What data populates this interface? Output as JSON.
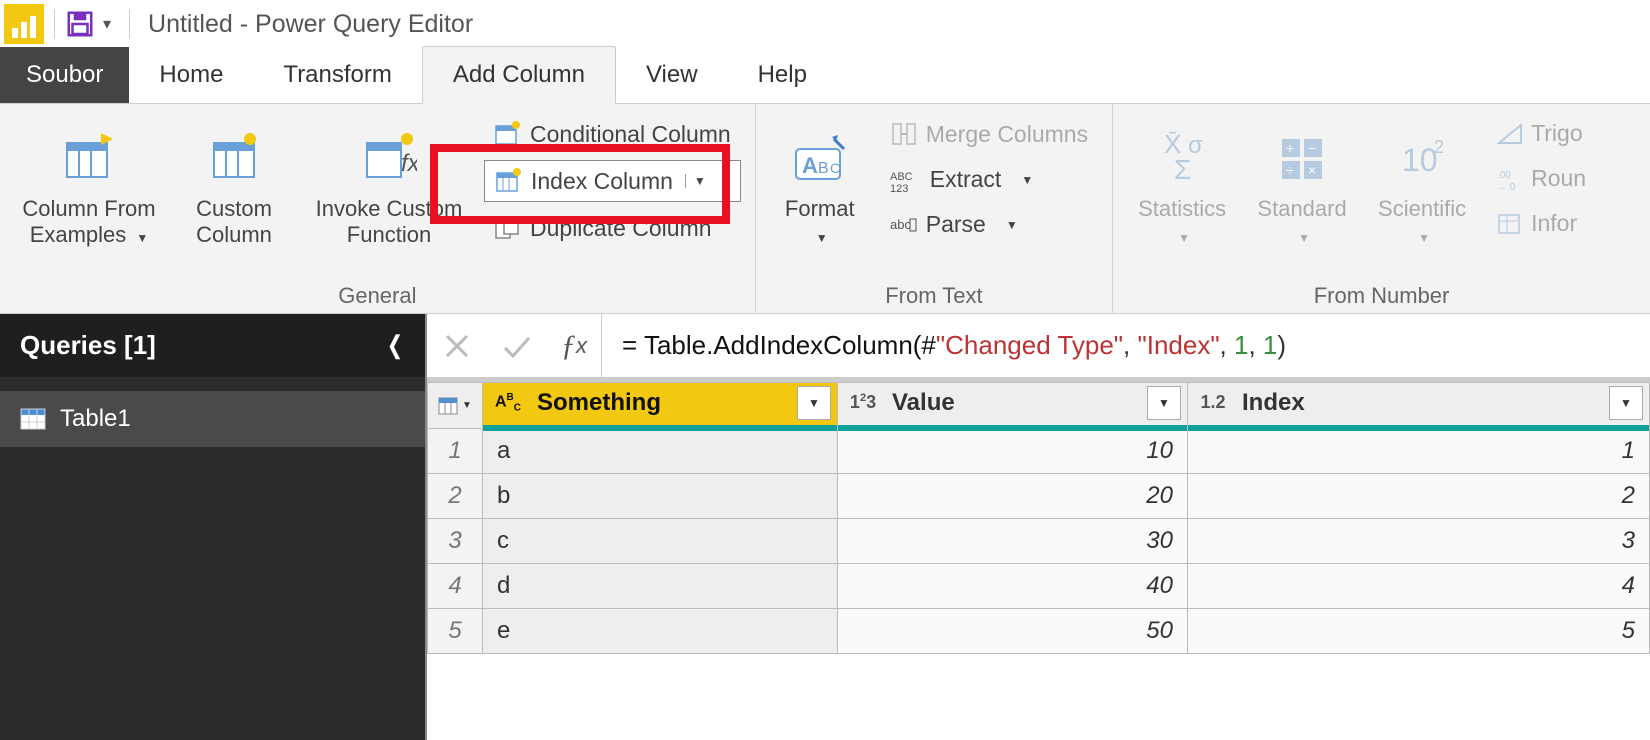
{
  "title_bar": {
    "window_title": "Untitled - Power Query Editor"
  },
  "tabs": {
    "file": "Soubor",
    "items": [
      "Home",
      "Transform",
      "Add Column",
      "View",
      "Help"
    ],
    "active_index": 2
  },
  "ribbon": {
    "general": {
      "label": "General",
      "column_from_examples": "Column From Examples",
      "custom_column": "Custom Column",
      "invoke_custom_function": "Invoke Custom Function",
      "conditional_column": "Conditional Column",
      "index_column": "Index Column",
      "duplicate_column": "Duplicate Column"
    },
    "from_text": {
      "label": "From Text",
      "format": "Format",
      "merge_columns": "Merge Columns",
      "extract": "Extract",
      "parse": "Parse"
    },
    "from_number": {
      "label": "From Number",
      "statistics": "Statistics",
      "standard": "Standard",
      "scientific": "Scientific",
      "trigonometry": "Trigo",
      "rounding": "Roun",
      "information": "Infor"
    }
  },
  "queries_panel": {
    "header": "Queries [1]",
    "items": [
      "Table1"
    ]
  },
  "formula_bar": {
    "prefix": "= Table.AddIndexColumn(#",
    "arg1": "\"Changed Type\"",
    "sep1": ", ",
    "arg2": "\"Index\"",
    "sep2": ", ",
    "arg3": "1",
    "sep3": ", ",
    "arg4": "1",
    "suffix": ")"
  },
  "grid": {
    "columns": [
      {
        "name": "Something",
        "type_label": "ABC",
        "selected": true
      },
      {
        "name": "Value",
        "type_label": "123",
        "selected": false
      },
      {
        "name": "Index",
        "type_label": "1.2",
        "selected": false
      }
    ],
    "rows": [
      {
        "n": "1",
        "cells": [
          "a",
          "10",
          "1"
        ]
      },
      {
        "n": "2",
        "cells": [
          "b",
          "20",
          "2"
        ]
      },
      {
        "n": "3",
        "cells": [
          "c",
          "30",
          "3"
        ]
      },
      {
        "n": "4",
        "cells": [
          "d",
          "40",
          "4"
        ]
      },
      {
        "n": "5",
        "cells": [
          "e",
          "50",
          "5"
        ]
      }
    ]
  }
}
